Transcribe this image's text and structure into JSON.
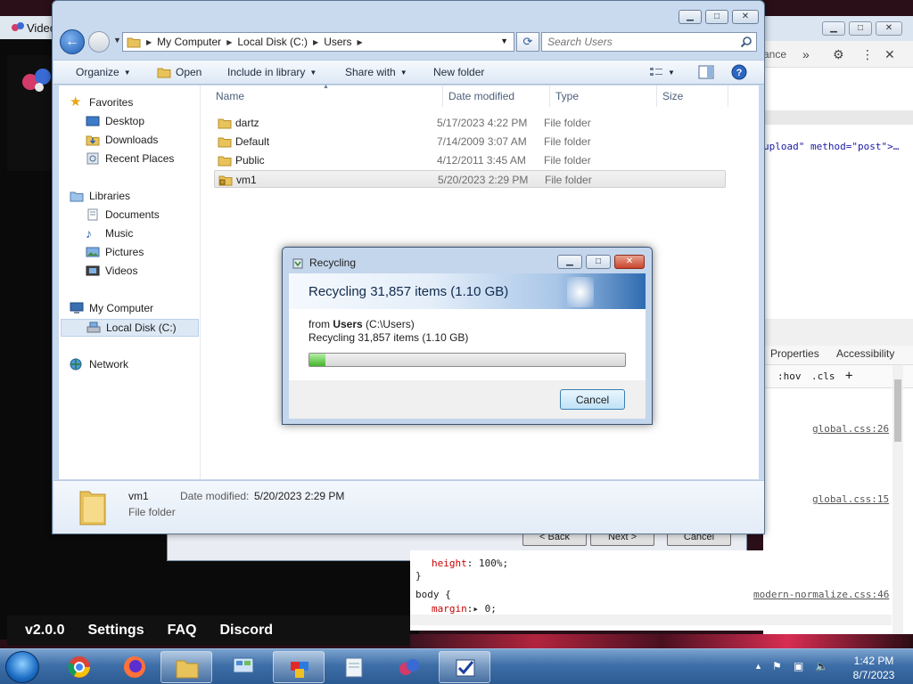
{
  "background_app": {
    "title": "Video",
    "footer": [
      "v2.0.0",
      "Settings",
      "FAQ",
      "Discord"
    ]
  },
  "background_wizard": {
    "buttons": [
      "< Back",
      "Next >",
      "Cancel"
    ]
  },
  "devtools": {
    "tab_partial": "ance",
    "code_line": "upload\" method=\"post\">…",
    "tabs": [
      "Properties",
      "Accessibility"
    ],
    "filter": [
      ":hov",
      ".cls",
      "+"
    ],
    "links": [
      "global.css:26",
      "global.css:15",
      "modern-normalize.css:46"
    ],
    "css": {
      "height_prop": "height",
      "height_val": "100%;",
      "close_brace": "}",
      "body_sel": "body {",
      "margin_prop": "margin",
      "margin_val": "0;"
    }
  },
  "explorer": {
    "address": {
      "crumbs": [
        "My Computer",
        "Local Disk (C:)",
        "Users"
      ]
    },
    "search_placeholder": "Search Users",
    "commands": {
      "organize": "Organize",
      "open": "Open",
      "include": "Include in library",
      "share": "Share with",
      "new_folder": "New folder"
    },
    "nav": {
      "favorites": "Favorites",
      "desktop": "Desktop",
      "downloads": "Downloads",
      "recent": "Recent Places",
      "libraries": "Libraries",
      "documents": "Documents",
      "music": "Music",
      "pictures": "Pictures",
      "videos": "Videos",
      "computer": "My Computer",
      "local_disk": "Local Disk (C:)",
      "network": "Network"
    },
    "columns": [
      "Name",
      "Date modified",
      "Type",
      "Size"
    ],
    "files": [
      {
        "name": "dartz",
        "date": "5/17/2023 4:22 PM",
        "type": "File folder"
      },
      {
        "name": "Default",
        "date": "7/14/2009 3:07 AM",
        "type": "File folder"
      },
      {
        "name": "Public",
        "date": "4/12/2011 3:45 AM",
        "type": "File folder"
      },
      {
        "name": "vm1",
        "date": "5/20/2023 2:29 PM",
        "type": "File folder"
      }
    ],
    "details": {
      "name": "vm1",
      "type": "File folder",
      "date_label": "Date modified:",
      "date_value": "5/20/2023 2:29 PM"
    }
  },
  "dialog": {
    "title": "Recycling",
    "header": "Recycling 31,857 items (1.10 GB)",
    "from_prefix": "from",
    "from_bold": "Users",
    "from_suffix": "(C:\\Users)",
    "status": "Recycling 31,857 items (1.10 GB)",
    "progress": 0.05,
    "cancel": "Cancel"
  },
  "taskbar": {
    "time": "1:42 PM",
    "date": "8/7/2023"
  },
  "colors": {
    "accent": "#2e6bb0",
    "progress_green": "#45b42a"
  }
}
